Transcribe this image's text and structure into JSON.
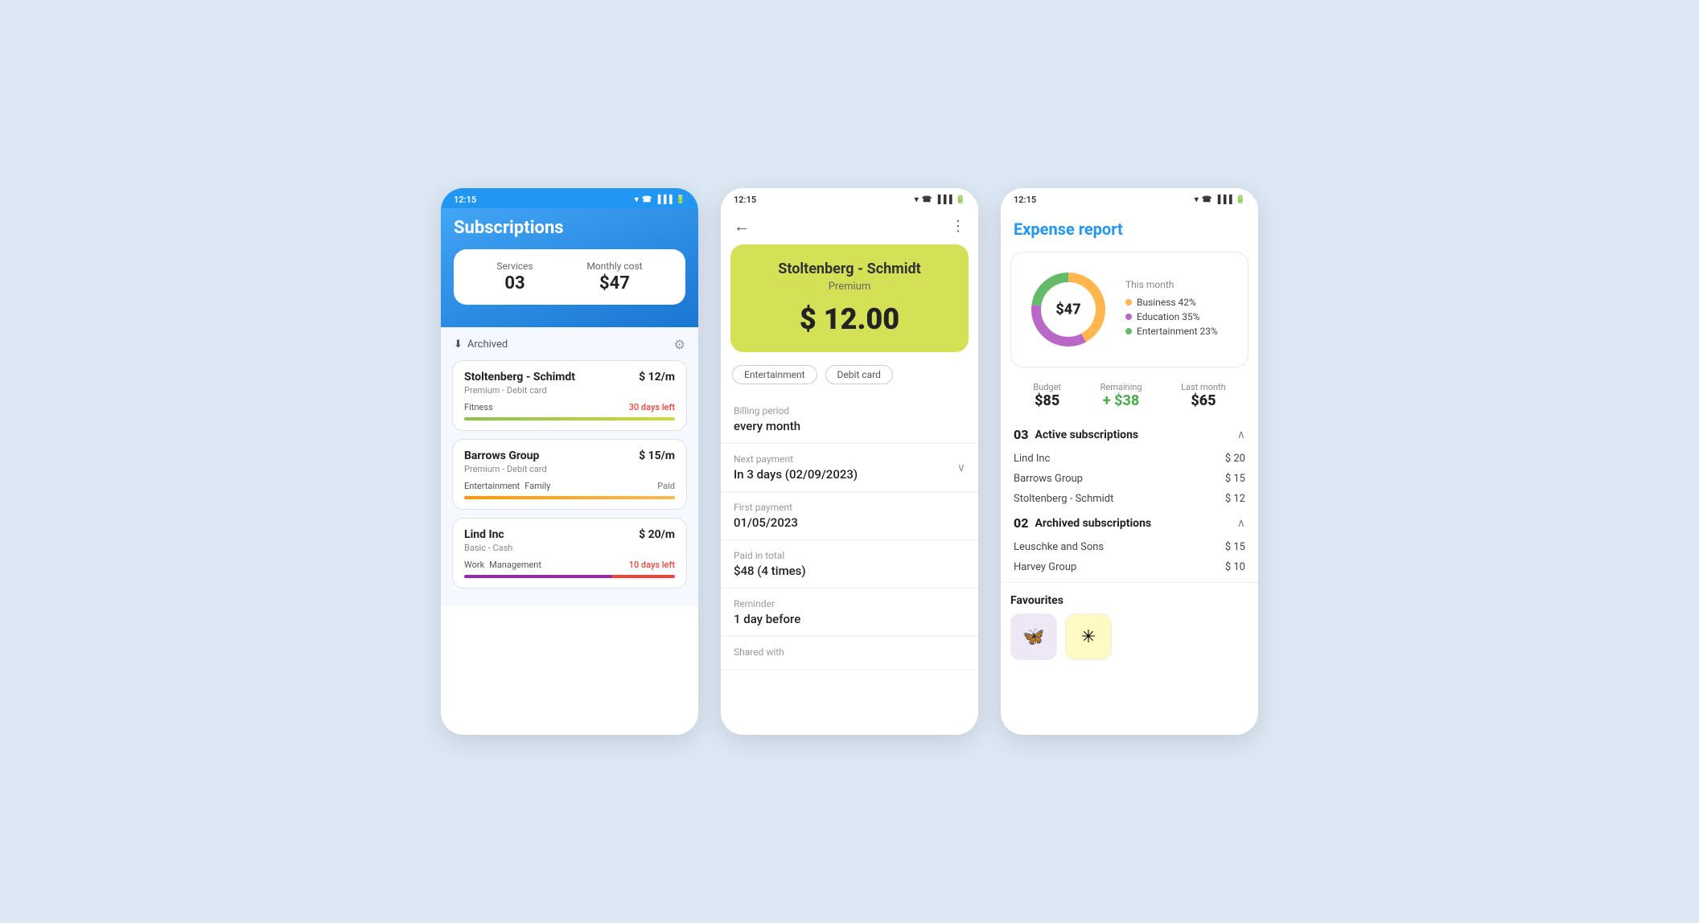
{
  "screen1": {
    "statusbar": {
      "time": "12:15"
    },
    "title": "Subscriptions",
    "summary": {
      "services_label": "Services",
      "services_value": "03",
      "cost_label": "Monthly cost",
      "cost_value": "$47"
    },
    "archived_label": "Archived",
    "filter_icon": "≡",
    "cards": [
      {
        "name": "Stoltenberg - Schimdt",
        "price": "$ 12/m",
        "meta": "Premium - Debit card",
        "tags": [
          "Fitness"
        ],
        "status": "30 days left",
        "status_type": "warning",
        "progress_type": "green"
      },
      {
        "name": "Barrows Group",
        "price": "$ 15/m",
        "meta": "Premium - Debit card",
        "tags": [
          "Entertainment",
          "Family"
        ],
        "status": "Paid",
        "status_type": "paid",
        "progress_type": "orange"
      },
      {
        "name": "Lind Inc",
        "price": "$ 20/m",
        "meta": "Basic - Cash",
        "tags": [
          "Work",
          "Management"
        ],
        "status": "10 days left",
        "status_type": "danger",
        "progress_type": "multi"
      }
    ]
  },
  "screen2": {
    "statusbar": {
      "time": "12:15"
    },
    "hero": {
      "name": "Stoltenberg - Schmidt",
      "tier": "Premium",
      "amount": "$ 12.00"
    },
    "tags": [
      "Entertainment",
      "Debit card"
    ],
    "rows": [
      {
        "label": "Billing period",
        "value": "every month",
        "collapsible": false
      },
      {
        "label": "Next payment",
        "value": "In 3 days (02/09/2023)",
        "collapsible": true
      },
      {
        "label": "First payment",
        "value": "01/05/2023",
        "collapsible": false
      },
      {
        "label": "Paid in total",
        "value": "$48  (4 times)",
        "collapsible": false
      },
      {
        "label": "Reminder",
        "value": "1 day before",
        "collapsible": false
      },
      {
        "label": "Shared with",
        "value": "",
        "collapsible": false
      }
    ]
  },
  "screen3": {
    "statusbar": {
      "time": "12:15"
    },
    "title": "Expense report",
    "donut": {
      "center_amount": "$47",
      "this_month": "This month",
      "legend": [
        {
          "label": "Business 42%",
          "color": "#ffb74d"
        },
        {
          "label": "Education 35%",
          "color": "#ce93d8"
        },
        {
          "label": "Entertainment 23%",
          "color": "#81c784"
        }
      ],
      "segments": [
        {
          "percent": 42,
          "color": "#ffb74d"
        },
        {
          "percent": 35,
          "color": "#ba68c8"
        },
        {
          "percent": 23,
          "color": "#66bb6a"
        }
      ]
    },
    "budget": [
      {
        "label": "Budget",
        "value": "$85",
        "type": "normal"
      },
      {
        "label": "Remaining",
        "value": "+ $38",
        "type": "green"
      },
      {
        "label": "Last month",
        "value": "$65",
        "type": "normal"
      }
    ],
    "active_count": "03",
    "active_label": "Active subscriptions",
    "active_items": [
      {
        "name": "Lind Inc",
        "price": "$ 20"
      },
      {
        "name": "Barrows Group",
        "price": "$ 15"
      },
      {
        "name": "Stoltenberg - Schmidt",
        "price": "$ 12"
      }
    ],
    "archived_count": "02",
    "archived_label": "Archived subscriptions",
    "archived_items": [
      {
        "name": "Leuschke and Sons",
        "price": "$ 15"
      },
      {
        "name": "Harvey Group",
        "price": "$ 10"
      }
    ],
    "favourites_label": "Favourites",
    "favourites": [
      {
        "icon": "🦋",
        "color": "#ede7f6"
      },
      {
        "icon": "✳",
        "color": "#fff9c4"
      }
    ]
  }
}
